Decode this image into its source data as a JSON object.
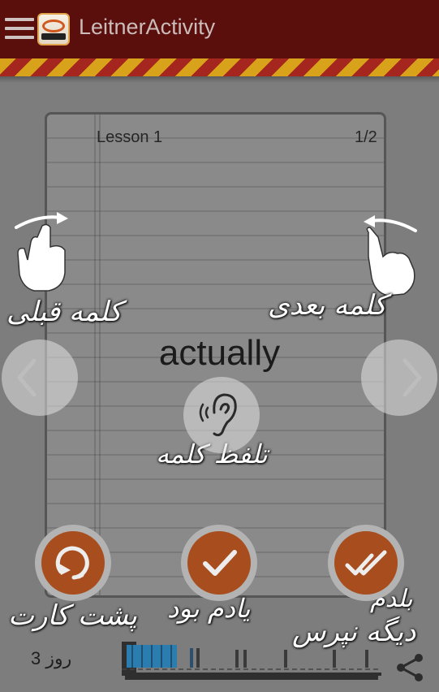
{
  "app": {
    "title": "LeitnerActivity"
  },
  "card": {
    "lesson_label": "Lesson 1",
    "page_indicator": "1/2",
    "word": "actually"
  },
  "hints": {
    "previous_word": "کلمه قبلی",
    "next_word": "کلمه بعدی",
    "pronounce_word": "تلفظ کلمه",
    "card_back": "پشت کارت",
    "remembered": "یادم بود",
    "know_it_line1": "بلدم",
    "know_it_line2": "دیگه نپرس"
  },
  "footer": {
    "day_label": "روز 3"
  },
  "colors": {
    "app_bar": "#5a0f0c",
    "hazard_yellow": "#d8a21a",
    "hazard_red": "#a5261e",
    "action_button": "#a84e1e",
    "overlay": "#7d7d7d"
  },
  "icons": {
    "menu": "menu-icon",
    "previous": "chevron-left-icon",
    "next": "chevron-right-icon",
    "pronounce": "ear-icon",
    "flip": "flip-card-icon",
    "remembered": "check-icon",
    "know_it": "double-check-icon",
    "share": "share-icon"
  }
}
